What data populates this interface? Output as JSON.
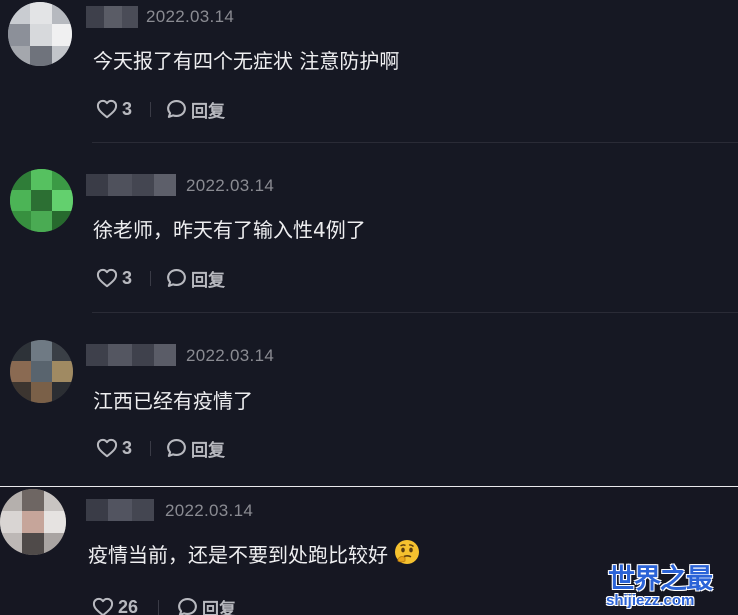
{
  "comments": [
    {
      "timestamp": "2022.03.14",
      "text": "今天报了有四个无症状 注意防护啊",
      "likes": "3",
      "reply_label": "回复"
    },
    {
      "timestamp": "2022.03.14",
      "text": "徐老师，昨天有了输入性4例了",
      "likes": "3",
      "reply_label": "回复"
    },
    {
      "timestamp": "2022.03.14",
      "text": "江西已经有疫情了",
      "likes": "3",
      "reply_label": "回复"
    },
    {
      "timestamp": "2022.03.14",
      "text": "疫情当前，还是不要到处跑比较好",
      "emoji": "thinking-face-emoji",
      "likes": "26",
      "reply_label": "回复"
    }
  ],
  "icons": {
    "like": "heart-outline-icon",
    "reply": "chat-bubble-icon"
  },
  "watermark": {
    "title": "世界之最",
    "url": "shijiezz.com"
  },
  "colors": {
    "background": "#161823",
    "text": "#eeeef0",
    "meta": "#8a8b92",
    "action": "#b8b9bf",
    "watermark": "#2b63d7"
  }
}
